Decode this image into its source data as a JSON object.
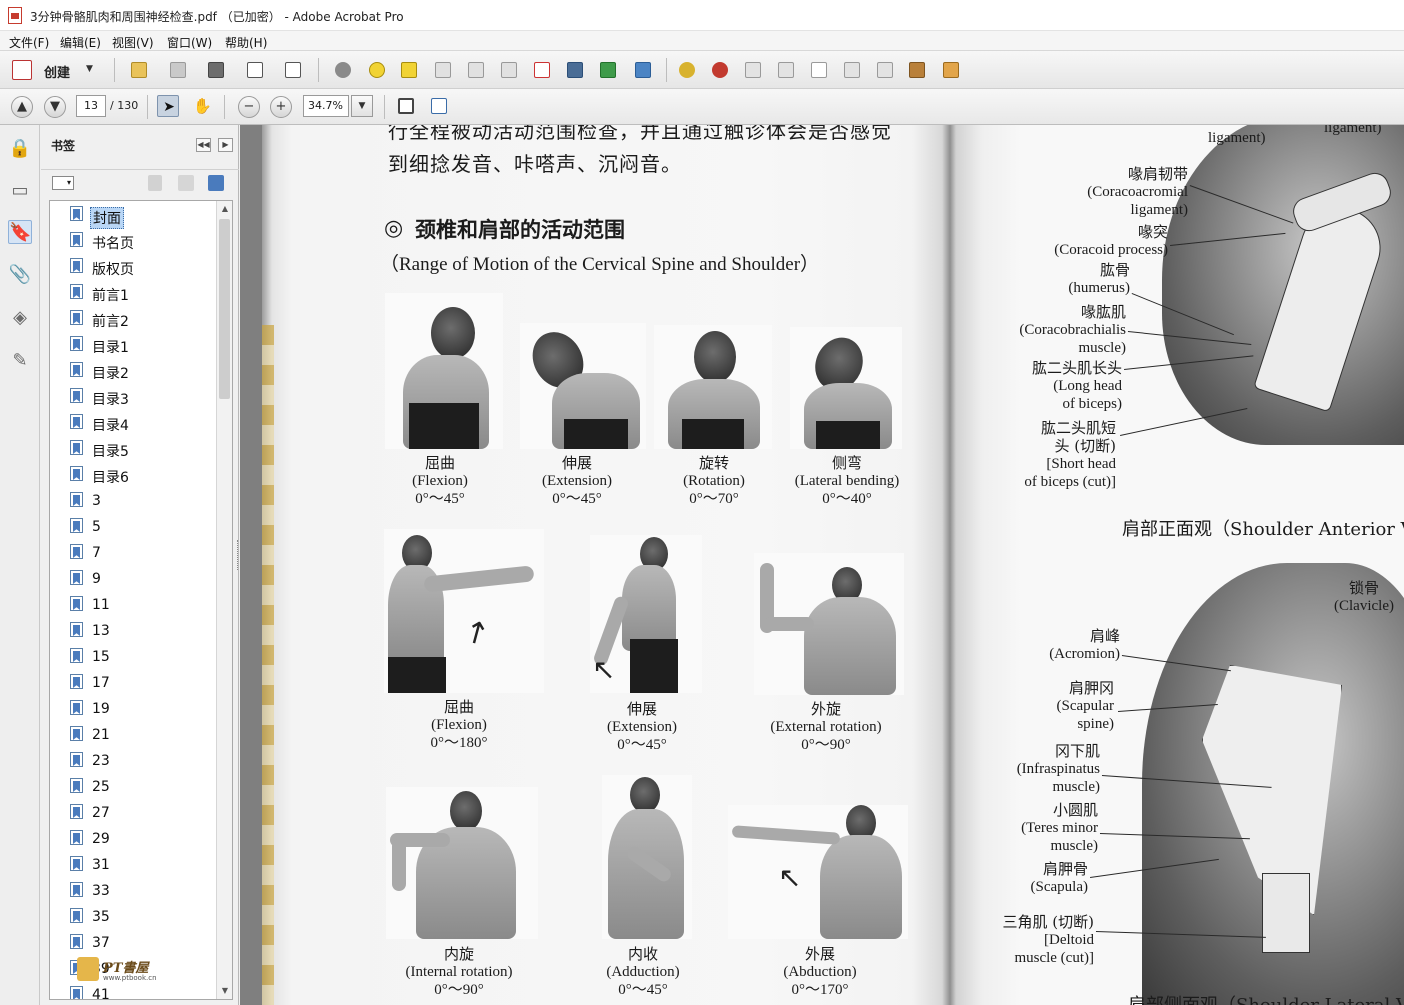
{
  "window": {
    "title": "3分钟骨骼肌肉和周围神经检查.pdf （已加密） - Adobe Acrobat Pro"
  },
  "menu": [
    "文件(F)",
    "编辑(E)",
    "视图(V)",
    "窗口(W)",
    "帮助(H)"
  ],
  "toolbar": {
    "create_label": "创建"
  },
  "nav": {
    "current_page": "13",
    "total_pages": "/ 130",
    "zoom": "34.7%"
  },
  "bookmarks_panel": {
    "title": "书签",
    "items": [
      "封面",
      "书名页",
      "版权页",
      "前言1",
      "前言2",
      "目录1",
      "目录2",
      "目录3",
      "目录4",
      "目录5",
      "目录6",
      "3",
      "5",
      "7",
      "9",
      "11",
      "13",
      "15",
      "17",
      "19",
      "21",
      "23",
      "25",
      "27",
      "29",
      "31",
      "33",
      "35",
      "37",
      "39",
      "41"
    ],
    "selected_index": 0
  },
  "watermark": {
    "line1": "PT書屋",
    "line2": "www.ptbook.cn"
  },
  "document": {
    "top_text_line1": "行全程被动活动范围检查，并且通过触诊体会是否感觉",
    "top_text_line2": "到细捻发音、咔嗒声、沉闷音。",
    "section_symbol": "◎",
    "section_title": "颈椎和肩部的活动范围",
    "section_subtitle": "（Range of Motion of the Cervical Spine and Shoulder）",
    "neck_captions": [
      {
        "zh": "屈曲",
        "en": "(Flexion)",
        "range": "0°～45°"
      },
      {
        "zh": "伸展",
        "en": "(Extension)",
        "range": "0°～45°"
      },
      {
        "zh": "旋转",
        "en": "(Rotation)",
        "range": "0°～70°"
      },
      {
        "zh": "侧弯",
        "en": "(Lateral bending)",
        "range": "0°～40°"
      }
    ],
    "shoulder_captions_row1": [
      {
        "zh": "屈曲",
        "en": "(Flexion)",
        "range": "0°～180°"
      },
      {
        "zh": "伸展",
        "en": "(Extension)",
        "range": "0°～45°"
      },
      {
        "zh": "外旋",
        "en": "(External rotation)",
        "range": "0°～90°"
      }
    ],
    "shoulder_captions_row2": [
      {
        "zh": "内旋",
        "en": "(Internal rotation)",
        "range": "0°～90°"
      },
      {
        "zh": "内收",
        "en": "(Adduction)",
        "range": "0°～45°"
      },
      {
        "zh": "外展",
        "en": "(Abduction)",
        "range": "0°～170°"
      }
    ],
    "anterior_labels": {
      "ligament_top_left": "ligament)",
      "ligament_top_right": "ligament)",
      "coracoacromial_zh": "喙肩韧带",
      "coracoacromial_en1": "(Coracoacromial",
      "coracoacromial_en2": "ligament)",
      "coracoid_zh": "喙突",
      "coracoid_en": "(Coracoid process)",
      "humerus_zh": "肱骨",
      "humerus_en": "(humerus)",
      "coracobrachialis_zh": "喙肱肌",
      "coracobrachialis_en1": "(Coracobrachialis",
      "coracobrachialis_en2": "muscle)",
      "biceps_long_zh": "肱二头肌长头",
      "biceps_long_en1": "(Long head",
      "biceps_long_en2": "of biceps)",
      "biceps_short_zh1": "肱二头肌短",
      "biceps_short_zh2": "头 (切断)",
      "biceps_short_en1": "[Short head",
      "biceps_short_en2": "of biceps (cut)]",
      "caption": "肩部正面观（Shoulder Anterior Vie"
    },
    "lateral_labels": {
      "clavicle_zh": "锁骨",
      "clavicle_en": "(Clavicle)",
      "acromion_zh": "肩峰",
      "acromion_en": "(Acromion)",
      "spine_zh": "肩胛冈",
      "spine_en1": "(Scapular",
      "spine_en2": "spine)",
      "infra_zh": "冈下肌",
      "infra_en1": "(Infraspinatus",
      "infra_en2": "muscle)",
      "teres_zh": "小圆肌",
      "teres_en1": "(Teres minor",
      "teres_en2": "muscle)",
      "scapula_zh": "肩胛骨",
      "scapula_en": "(Scapula)",
      "deltoid_zh": "三角肌 (切断)",
      "deltoid_en1": "[Deltoid",
      "deltoid_en2": "muscle (cut)]",
      "caption": "肩部侧面观（Shoulder Lateral Vie"
    }
  }
}
